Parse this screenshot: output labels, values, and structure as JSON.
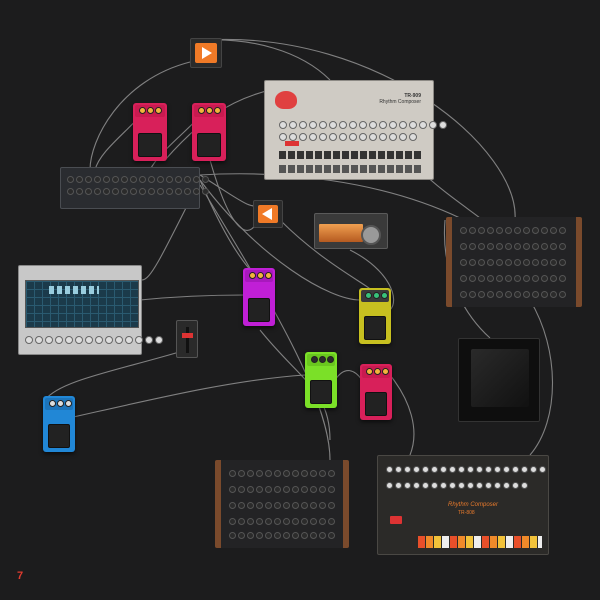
{
  "app": {
    "logo_glyph": "7"
  },
  "devices": {
    "drum_machine_909": {
      "brand": "Rhythm Composer",
      "model": "TR-909"
    },
    "drum_machine_808": {
      "brand": "Rhythm Composer",
      "model": "TR-808"
    }
  },
  "colors": {
    "background": "#1c1c1d",
    "cable": "#9a9a9a",
    "pedal_pink": "#d8205a",
    "pedal_magenta": "#c01fd6",
    "pedal_yellow": "#c7c020",
    "pedal_green": "#7be028",
    "pedal_blue": "#2187d6",
    "play_orange": "#f07a27",
    "wood": "#7a4a2c"
  }
}
